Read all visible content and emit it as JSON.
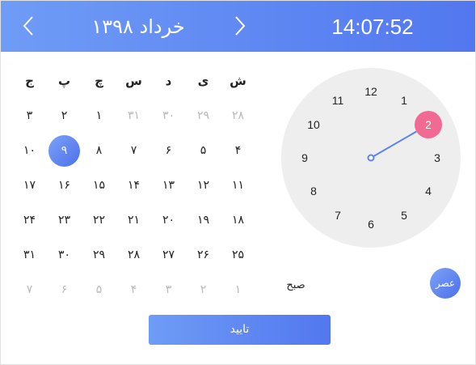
{
  "header": {
    "month_title": "خرداد ۱۳۹۸",
    "time": "14:07:52",
    "prev_icon": "chevron-left-icon",
    "next_icon": "chevron-right-icon"
  },
  "calendar": {
    "weekdays": [
      "ش",
      "ی",
      "د",
      "س",
      "چ",
      "پ",
      "ج"
    ],
    "weeks": [
      [
        {
          "t": "۲۸",
          "m": true
        },
        {
          "t": "۲۹",
          "m": true
        },
        {
          "t": "۳۰",
          "m": true
        },
        {
          "t": "۳۱",
          "m": true
        },
        {
          "t": "۱"
        },
        {
          "t": "۲"
        },
        {
          "t": "۳"
        }
      ],
      [
        {
          "t": "۴"
        },
        {
          "t": "۵"
        },
        {
          "t": "۶"
        },
        {
          "t": "۷"
        },
        {
          "t": "۸"
        },
        {
          "t": "۹",
          "s": true
        },
        {
          "t": "۱۰"
        }
      ],
      [
        {
          "t": "۱۱"
        },
        {
          "t": "۱۲"
        },
        {
          "t": "۱۳"
        },
        {
          "t": "۱۴"
        },
        {
          "t": "۱۵"
        },
        {
          "t": "۱۶"
        },
        {
          "t": "۱۷"
        }
      ],
      [
        {
          "t": "۱۸"
        },
        {
          "t": "۱۹"
        },
        {
          "t": "۲۰"
        },
        {
          "t": "۲۱"
        },
        {
          "t": "۲۲"
        },
        {
          "t": "۲۳"
        },
        {
          "t": "۲۴"
        }
      ],
      [
        {
          "t": "۲۵"
        },
        {
          "t": "۲۶"
        },
        {
          "t": "۲۷"
        },
        {
          "t": "۲۸"
        },
        {
          "t": "۲۹"
        },
        {
          "t": "۳۰"
        },
        {
          "t": "۳۱"
        }
      ],
      [
        {
          "t": "۱",
          "m": true
        },
        {
          "t": "۲",
          "m": true
        },
        {
          "t": "۳",
          "m": true
        },
        {
          "t": "۴",
          "m": true
        },
        {
          "t": "۵",
          "m": true
        },
        {
          "t": "۶",
          "m": true
        },
        {
          "t": "۷",
          "m": true
        }
      ]
    ]
  },
  "clock": {
    "numbers": [
      "12",
      "1",
      "2",
      "3",
      "4",
      "5",
      "6",
      "7",
      "8",
      "9",
      "10",
      "11"
    ],
    "selected_hour": "2",
    "hand_color": "#5b84f1",
    "highlight_color": "#f06a93"
  },
  "ampm": {
    "am_label": "صبح",
    "pm_label": "عصر"
  },
  "confirm_label": "تایید",
  "colors": {
    "accent": "#5b84f1",
    "muted": "#b8b8b8",
    "clock_bg": "#eeeeee"
  }
}
